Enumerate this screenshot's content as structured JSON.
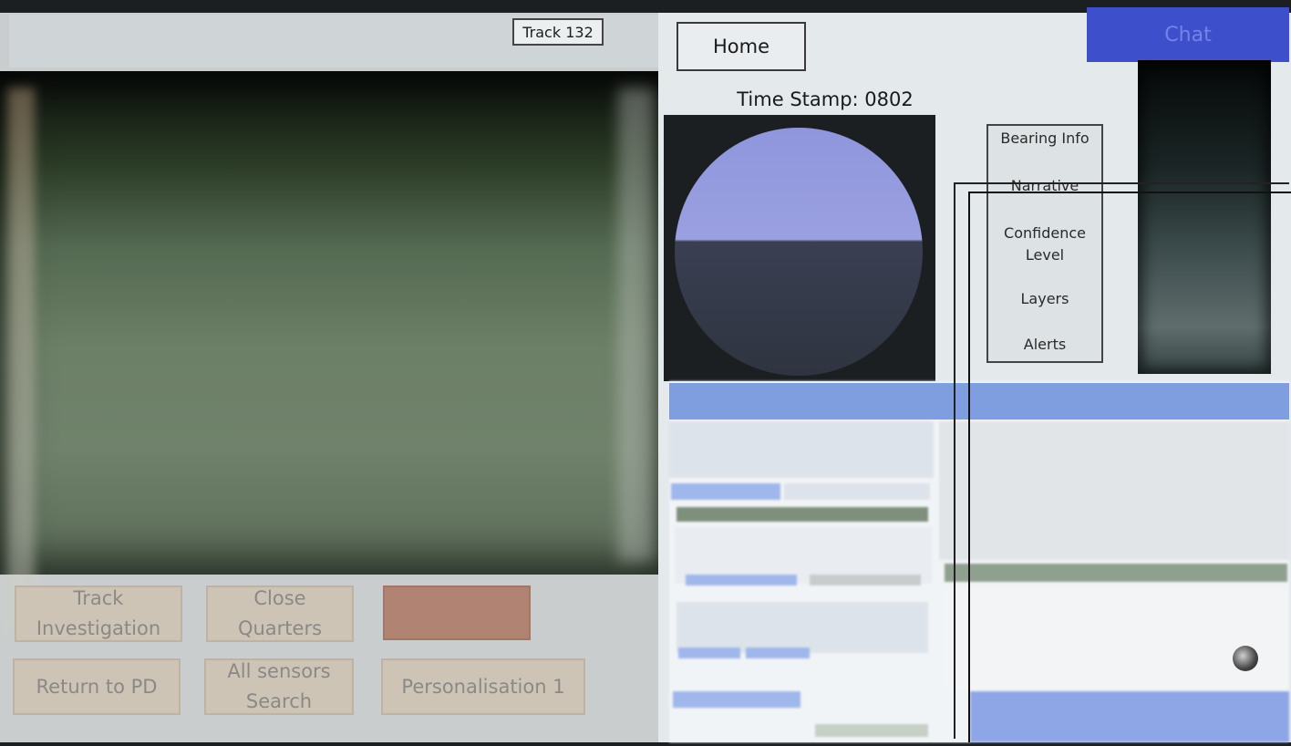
{
  "left_panel": {
    "track_label": "Track 132",
    "buttons": {
      "track_investigation": "Track\nInvestigation",
      "close_quarters": "Close\nQuarters",
      "red_button": "",
      "return_to_pd": "Return to PD",
      "all_sensors_search": "All sensors\nSearch",
      "personalisation": "Personalisation 1"
    }
  },
  "right_panel": {
    "home_label": "Home",
    "chat_label": "Chat",
    "timestamp": "Time Stamp: 0802",
    "menu": [
      "Bearing Info",
      "Narrative",
      "Confidence\nLevel",
      "Layers",
      "Alerts"
    ]
  },
  "colors": {
    "chat": "#3e4fcc",
    "button_fill": "#cdc4b6",
    "alert_button": "#b08373",
    "embedded_header": "#7f9ee0"
  },
  "icons": {
    "scroll": "scroll-knob-icon"
  }
}
